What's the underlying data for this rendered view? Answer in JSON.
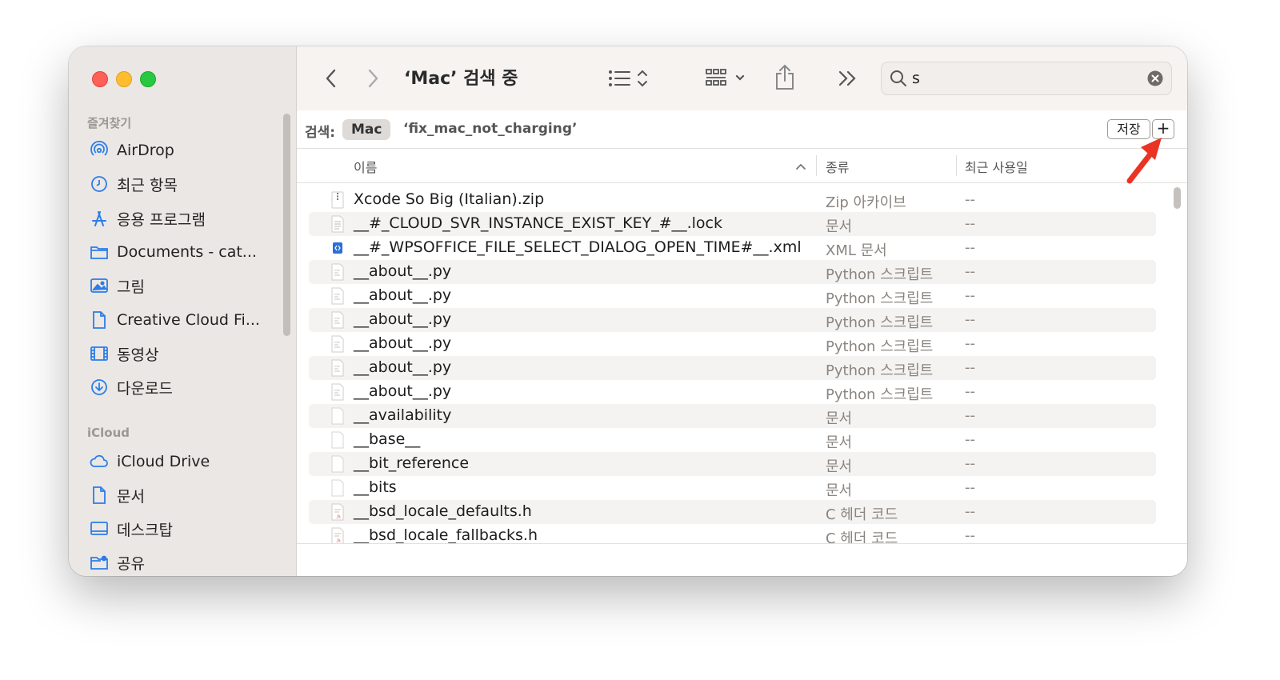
{
  "window": {
    "title": "‘Mac’ 검색 중"
  },
  "sidebar": {
    "favorites_title": "즐겨찾기",
    "favorites": [
      {
        "label": "AirDrop",
        "icon": "airdrop-icon"
      },
      {
        "label": "최근 항목",
        "icon": "clock-icon"
      },
      {
        "label": "응용 프로그램",
        "icon": "applications-icon"
      },
      {
        "label": "Documents - cat...",
        "icon": "folder-icon"
      },
      {
        "label": "그림",
        "icon": "photo-icon"
      },
      {
        "label": "Creative Cloud Fi...",
        "icon": "file-icon"
      },
      {
        "label": "동영상",
        "icon": "film-icon"
      },
      {
        "label": "다운로드",
        "icon": "download-icon"
      }
    ],
    "icloud_title": "iCloud",
    "icloud": [
      {
        "label": "iCloud Drive",
        "icon": "cloud-icon"
      },
      {
        "label": "문서",
        "icon": "document-icon"
      },
      {
        "label": "데스크탑",
        "icon": "desktop-icon"
      },
      {
        "label": "공유",
        "icon": "shared-folder-icon"
      }
    ]
  },
  "search": {
    "value": "s"
  },
  "scope": {
    "label": "검색:",
    "location": "Mac",
    "query": "‘fix_mac_not_charging’",
    "save_label": "저장",
    "add_label": "+"
  },
  "columns": {
    "name": "이름",
    "kind": "종류",
    "date": "최근 사용일"
  },
  "files": [
    {
      "name": "Xcode So Big (Italian).zip",
      "kind": "Zip 아카이브",
      "date": "--",
      "icon": "zip-icon"
    },
    {
      "name": "__#_CLOUD_SVR_INSTANCE_EXIST_KEY_#__.lock",
      "kind": "문서",
      "date": "--",
      "icon": "text-file-icon"
    },
    {
      "name": "__#_WPSOFFICE_FILE_SELECT_DIALOG_OPEN_TIME#__.xml",
      "kind": "XML 문서",
      "date": "--",
      "icon": "xml-file-icon"
    },
    {
      "name": "__about__.py",
      "kind": "Python 스크립트",
      "date": "--",
      "icon": "python-file-icon"
    },
    {
      "name": "__about__.py",
      "kind": "Python 스크립트",
      "date": "--",
      "icon": "python-file-icon"
    },
    {
      "name": "__about__.py",
      "kind": "Python 스크립트",
      "date": "--",
      "icon": "python-file-icon"
    },
    {
      "name": "__about__.py",
      "kind": "Python 스크립트",
      "date": "--",
      "icon": "python-file-icon"
    },
    {
      "name": "__about__.py",
      "kind": "Python 스크립트",
      "date": "--",
      "icon": "python-file-icon"
    },
    {
      "name": "__about__.py",
      "kind": "Python 스크립트",
      "date": "--",
      "icon": "python-file-icon"
    },
    {
      "name": "__availability",
      "kind": "문서",
      "date": "--",
      "icon": "blank-file-icon"
    },
    {
      "name": "__base__",
      "kind": "문서",
      "date": "--",
      "icon": "blank-file-icon"
    },
    {
      "name": "__bit_reference",
      "kind": "문서",
      "date": "--",
      "icon": "blank-file-icon"
    },
    {
      "name": "__bits",
      "kind": "문서",
      "date": "--",
      "icon": "blank-file-icon"
    },
    {
      "name": "__bsd_locale_defaults.h",
      "kind": "C 헤더 코드",
      "date": "--",
      "icon": "header-file-icon"
    },
    {
      "name": "__bsd_locale_fallbacks.h",
      "kind": "C 헤더 코드",
      "date": "--",
      "icon": "header-file-icon"
    }
  ],
  "colors": {
    "accent": "#2b7de9",
    "annotation_arrow": "#ea3323"
  }
}
